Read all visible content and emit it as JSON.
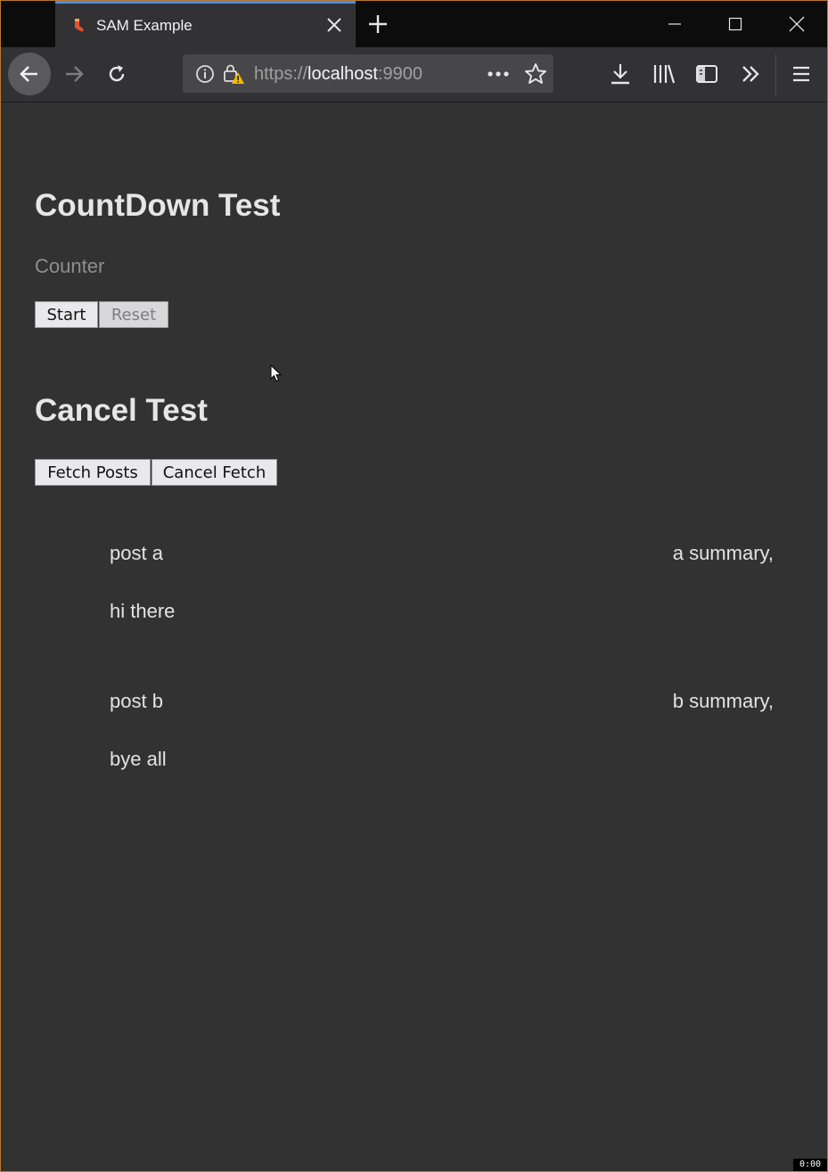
{
  "browser": {
    "tab_title": "SAM Example",
    "url_scheme": "https://",
    "url_host": "localhost",
    "url_port": ":9900",
    "accent_color": "#4a8fe0"
  },
  "page": {
    "countdown_heading": "CountDown Test",
    "counter_label": "Counter",
    "start_label": "Start",
    "reset_label": "Reset",
    "cancel_heading": "Cancel Test",
    "fetch_label": "Fetch Posts",
    "cancel_fetch_label": "Cancel Fetch",
    "posts": [
      {
        "title": "post a",
        "summary": "a summary,",
        "body": "hi there"
      },
      {
        "title": "post b",
        "summary": "b summary,",
        "body": "bye all"
      }
    ]
  },
  "overlay": {
    "clock": "0:00"
  }
}
